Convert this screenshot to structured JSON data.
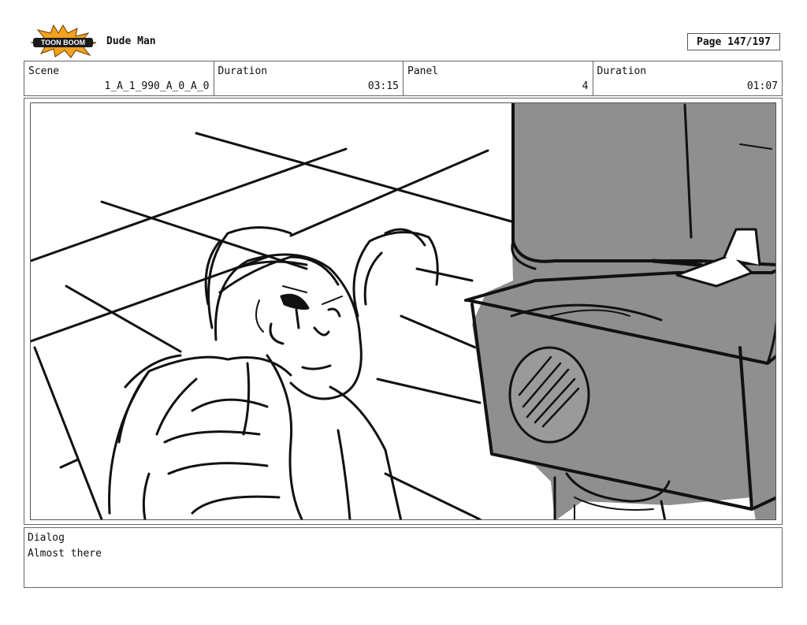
{
  "header": {
    "logo_text": "TOON BOOM",
    "project_title": "Dude Man",
    "page_label": "Page 147/197"
  },
  "info": {
    "scene_label": "Scene",
    "scene_value": "1_A_1_990_A_0_A_0",
    "duration_label": "Duration",
    "duration_value": "03:15",
    "panel_label": "Panel",
    "panel_value": "4",
    "panel_duration_label": "Duration",
    "panel_duration_value": "01:07"
  },
  "dialog": {
    "label": "Dialog",
    "text": "Almost there"
  }
}
